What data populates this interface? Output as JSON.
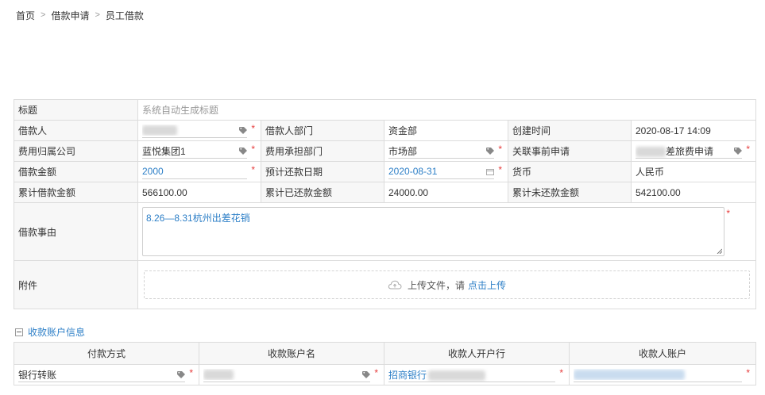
{
  "breadcrumb": {
    "home": "首页",
    "level2": "借款申请",
    "level3": "员工借款"
  },
  "form": {
    "title_label": "标题",
    "title_placeholder": "系统自动生成标题",
    "borrower_label": "借款人",
    "borrower_dept_label": "借款人部门",
    "borrower_dept_value": "资金部",
    "created_time_label": "创建时间",
    "created_time_value": "2020-08-17 14:09",
    "company_label": "费用归属公司",
    "company_value": "蓝悦集团1",
    "cost_dept_label": "费用承担部门",
    "cost_dept_value": "市场部",
    "related_label": "关联事前申请",
    "related_value": "差旅费申请",
    "amount_label": "借款金额",
    "amount_value": "2000",
    "repay_date_label": "预计还款日期",
    "repay_date_value": "2020-08-31",
    "currency_label": "货币",
    "currency_value": "人民币",
    "cum_borrow_label": "累计借款金额",
    "cum_borrow_value": "566100.00",
    "cum_repaid_label": "累计已还款金额",
    "cum_repaid_value": "24000.00",
    "cum_unpaid_label": "累计未还款金额",
    "cum_unpaid_value": "542100.00",
    "reason_label": "借款事由",
    "reason_value": "8.26—8.31杭州出差花销",
    "attachment_label": "附件",
    "upload_text": "上传文件，请",
    "upload_link": "点击上传"
  },
  "account": {
    "section_title": "收款账户信息",
    "headers": [
      "付款方式",
      "收款账户名",
      "收款人开户行",
      "收款人账户"
    ],
    "pay_method": "银行转账",
    "bank": "招商银行"
  },
  "required_mark": "*"
}
